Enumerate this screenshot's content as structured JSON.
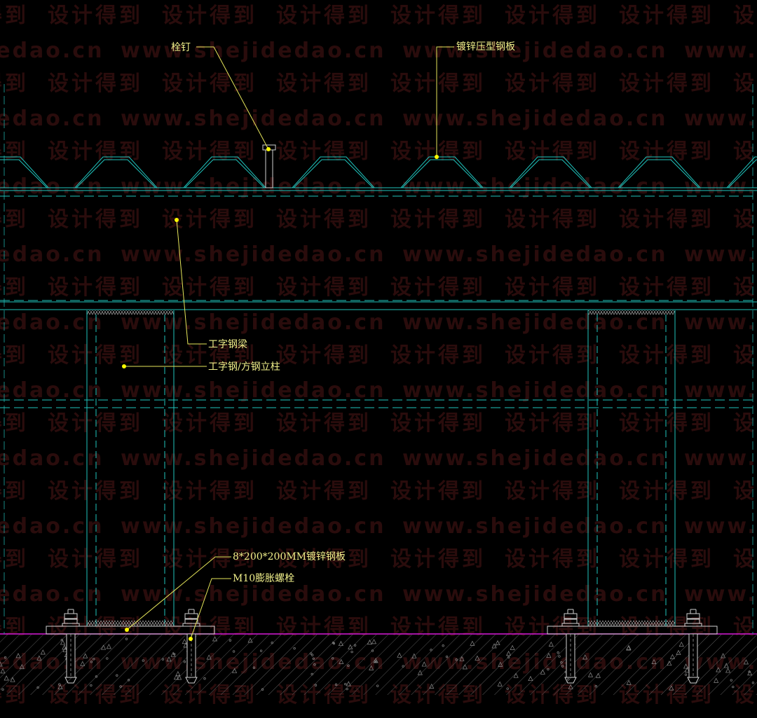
{
  "watermark": {
    "cn": "设计得到",
    "en": "www.shejidedao.cn"
  },
  "labels": {
    "shear_stud": "栓钉",
    "deck_plate": "镀锌压型钢板",
    "i_beam": "工字钢梁",
    "column": "工字钢/方钢立柱",
    "base_plate": "8*200*200MM镀锌钢板",
    "anchor_bolt": "M10膨胀螺栓"
  },
  "colors": {
    "background": "#000000",
    "structure_line": "#1fc4bd",
    "leader_line": "#e6e65a",
    "leader_dot": "#ffff00",
    "label_text": "#f0ef8a",
    "ground_line": "#d81ad8",
    "watermark": "#2a0c0c"
  }
}
